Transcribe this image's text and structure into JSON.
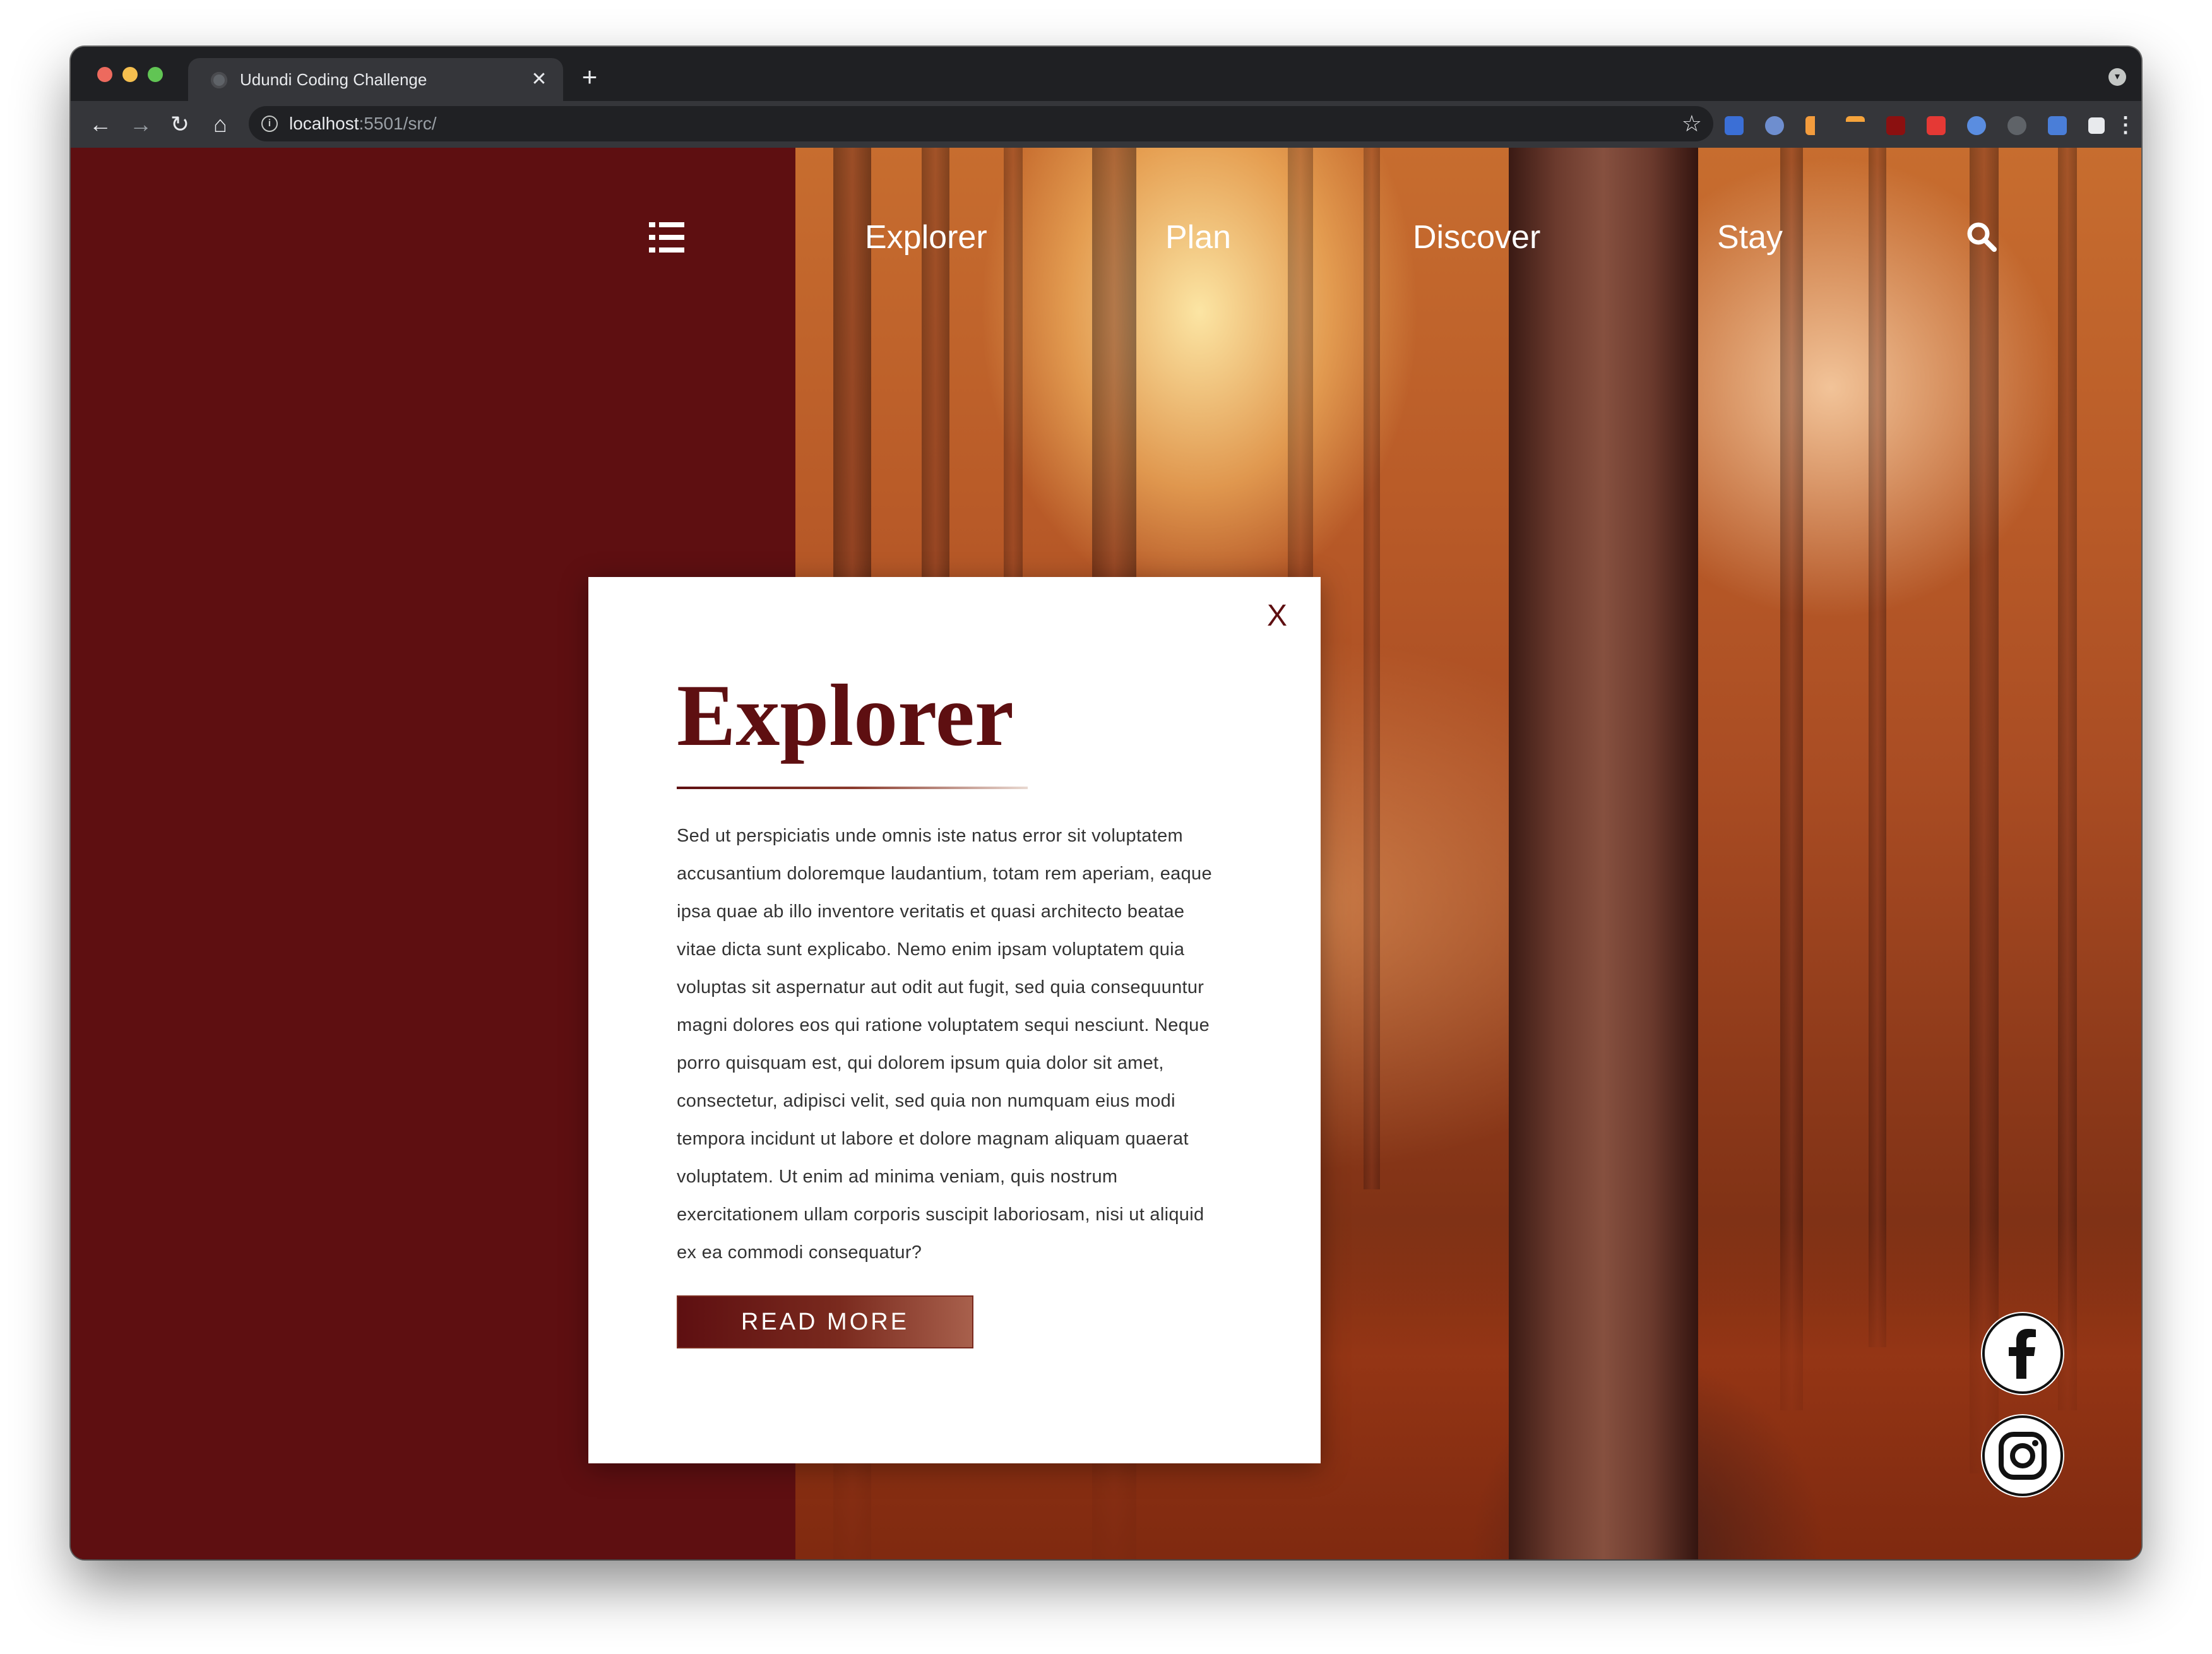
{
  "browser": {
    "tab": {
      "title": "Udundi Coding Challenge",
      "close_glyph": "✕"
    },
    "new_tab_glyph": "+",
    "nav": {
      "back": "←",
      "forward": "→",
      "reload": "↻",
      "home": "⌂"
    },
    "address": {
      "host": "localhost",
      "rest": ":5501/src/"
    },
    "star_glyph": "☆",
    "menu_glyph": "⋮",
    "extensions": [
      "shield-ext",
      "pin-ext",
      "chart-ext",
      "flag-ext",
      "ublock-ext",
      "youtube-ext",
      "compass-ext",
      "sync-ext",
      "translate-ext",
      "puzzle-ext",
      "profile-avatar"
    ],
    "colors": {
      "chrome_dark": "#202124",
      "toolbar": "#35363a"
    }
  },
  "site": {
    "nav": {
      "menu_icon": "list-icon",
      "links": [
        "Explorer",
        "Plan",
        "Discover",
        "Stay"
      ],
      "search_icon": "search-icon"
    },
    "card": {
      "close_label": "X",
      "title": "Explorer",
      "body": "Sed ut perspiciatis unde omnis iste natus error sit voluptatem accusantium doloremque laudantium, totam rem aperiam, eaque ipsa quae ab illo inventore veritatis et quasi architecto beatae vitae dicta sunt explicabo. Nemo enim ipsam voluptatem quia voluptas sit aspernatur aut odit aut fugit, sed quia consequuntur magni dolores eos qui ratione voluptatem sequi nesciunt. Neque porro quisquam est, qui dolorem ipsum quia dolor sit amet, consectetur, adipisci velit, sed quia non numquam eius modi tempora incidunt ut labore et dolore magnam aliquam quaerat voluptatem. Ut enim ad minima veniam, quis nostrum exercitationem ullam corporis suscipit laboriosam, nisi ut aliquid ex ea commodi consequatur?",
      "button_label": "READ MORE"
    },
    "social": [
      "facebook-icon",
      "instagram-icon"
    ],
    "colors": {
      "brand_maroon": "#5e0f11",
      "card_bg": "#ffffff",
      "nav_text": "#ffffff"
    }
  }
}
